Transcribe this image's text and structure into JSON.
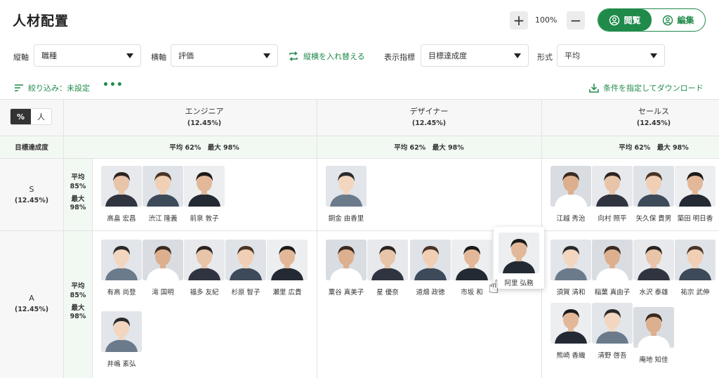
{
  "header": {
    "title": "人材配置",
    "zoom": "100%",
    "plus": "+",
    "minus": "−",
    "view_label": "閲覧",
    "edit_label": "編集"
  },
  "filters": {
    "vertical_label": "縦軸",
    "vertical_value": "職種",
    "horizontal_label": "横軸",
    "horizontal_value": "評価",
    "swap_label": "縦横を入れ替える",
    "metric_label": "表示指標",
    "metric_value": "目標達成度",
    "format_label": "形式",
    "format_value": "平均"
  },
  "toolbar": {
    "filter_label": "絞り込み：未設定",
    "more": "•••",
    "download_label": "条件を指定してダウンロード"
  },
  "unit_toggle": {
    "percent": "%",
    "person": "人"
  },
  "columns": [
    {
      "name": "エンジニア",
      "pct": "(12.45%)",
      "stats": "平均 62%　最大 98%"
    },
    {
      "name": "デザイナー",
      "pct": "(12.45%)",
      "stats": "平均 62%　最大 98%"
    },
    {
      "name": "セールス",
      "pct": "(12.45%)",
      "stats": "平均 62%　最大 98%"
    }
  ],
  "metric_row_label": "目標達成度",
  "rows": [
    {
      "name": "S",
      "pct": "(12.45%)",
      "avg_label": "平均",
      "avg": "85%",
      "max_label": "最大",
      "max": "98%"
    },
    {
      "name": "A",
      "pct": "(12.45%)",
      "avg_label": "平均",
      "avg": "85%",
      "max_label": "最大",
      "max": "98%"
    }
  ],
  "people": {
    "s_eng": [
      "高畠 宏昌",
      "渋江 隆義",
      "前泉 敦子"
    ],
    "s_des": [
      "銅金 由香里"
    ],
    "s_sales": [
      "江越 秀治",
      "向村 照平",
      "矢久保 貴男",
      "築田 明日香"
    ],
    "a_eng": [
      "有高 尚登",
      "滝 国明",
      "福多 友紀",
      "杉原 智子",
      "瀬里 広貴",
      "井嶋 素弘"
    ],
    "a_des": [
      "粟谷 真美子",
      "星 優奈",
      "道畑 政徳",
      "市坂 和"
    ],
    "a_sales": [
      "須賀 清和",
      "稲葉 真由子",
      "水沢 泰雄",
      "祐宗 武伸",
      "熊崎 香織",
      "清野 啓吾",
      "庵地 知佳"
    ],
    "dragging": "阿里 弘務"
  },
  "colors": {
    "accent": "#1f8a4a",
    "header_bg": "#f2f9f3",
    "label_bg": "#f5f5f5"
  }
}
